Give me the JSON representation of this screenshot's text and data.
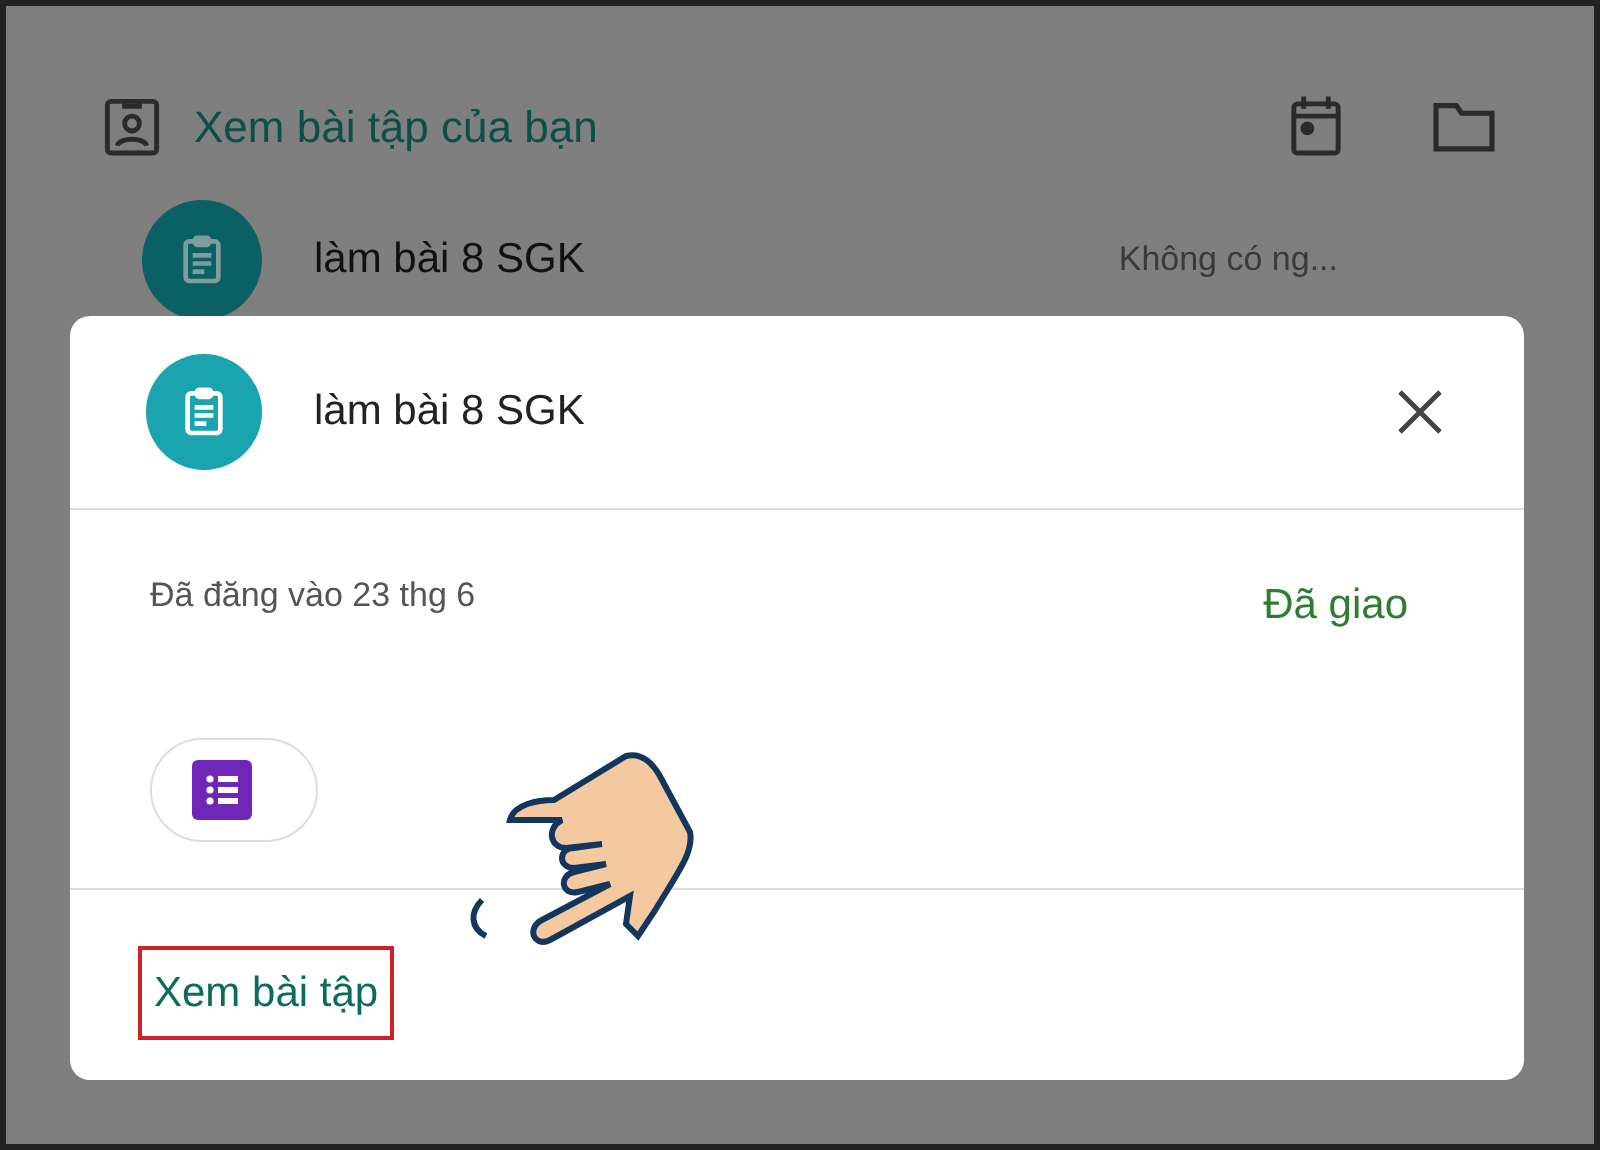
{
  "header": {
    "title": "Xem bài tập của bạn"
  },
  "list": [
    {
      "title": "làm bài 8 SGK",
      "due": "Không có ng..."
    }
  ],
  "dialog": {
    "title": "làm bài 8 SGK",
    "posted": "Đã đăng vào 23 thg 6",
    "status": "Đã giao",
    "action": "Xem bài tập"
  }
}
